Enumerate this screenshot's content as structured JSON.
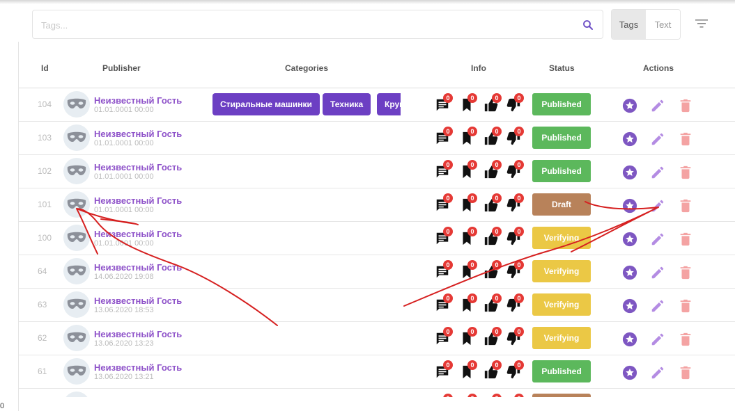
{
  "search": {
    "placeholder": "Tags..."
  },
  "toggle": {
    "tags_label": "Tags",
    "text_label": "Text"
  },
  "columns": [
    "Id",
    "Publisher",
    "Categories",
    "Info",
    "Status",
    "Actions"
  ],
  "corner_text": "0",
  "colors": {
    "published": "#5cb85c",
    "draft": "#b8825a",
    "verifying": "#ebc845",
    "chip": "#6c3fc3",
    "publisher": "#8e52c9",
    "badge": "#e53935",
    "annotation": "#d62020"
  },
  "categories_row1": [
    "Стиральные машинки",
    "Техника",
    "Крупная бытовая техника"
  ],
  "rows": [
    {
      "id": "104",
      "name": "Неизвестный Гость",
      "date": "01.01.0001 00:00",
      "status": "Published",
      "comments": "0",
      "saves": "0",
      "likes": "0",
      "dislikes": "0"
    },
    {
      "id": "103",
      "name": "Неизвестный Гость",
      "date": "01.01.0001 00:00",
      "status": "Published",
      "comments": "0",
      "saves": "0",
      "likes": "0",
      "dislikes": "0"
    },
    {
      "id": "102",
      "name": "Неизвестный Гость",
      "date": "01.01.0001 00:00",
      "status": "Published",
      "comments": "0",
      "saves": "0",
      "likes": "0",
      "dislikes": "0"
    },
    {
      "id": "101",
      "name": "Неизвестный Гость",
      "date": "01.01.0001 00:00",
      "status": "Draft",
      "comments": "0",
      "saves": "0",
      "likes": "0",
      "dislikes": "0"
    },
    {
      "id": "100",
      "name": "Неизвестный Гость",
      "date": "01.01.0001 00:00",
      "status": "Verifying",
      "comments": "0",
      "saves": "0",
      "likes": "0",
      "dislikes": "0"
    },
    {
      "id": "64",
      "name": "Неизвестный Гость",
      "date": "14.06.2020 19:08",
      "status": "Verifying",
      "comments": "0",
      "saves": "0",
      "likes": "0",
      "dislikes": "0"
    },
    {
      "id": "63",
      "name": "Неизвестный Гость",
      "date": "13.06.2020 18:53",
      "status": "Verifying",
      "comments": "0",
      "saves": "0",
      "likes": "0",
      "dislikes": "0"
    },
    {
      "id": "62",
      "name": "Неизвестный Гость",
      "date": "13.06.2020 13:23",
      "status": "Verifying",
      "comments": "0",
      "saves": "0",
      "likes": "0",
      "dislikes": "0"
    },
    {
      "id": "61",
      "name": "Неизвестный Гость",
      "date": "13.06.2020 13:21",
      "status": "Published",
      "comments": "0",
      "saves": "0",
      "likes": "0",
      "dislikes": "0"
    },
    {
      "id": "",
      "name": "",
      "date": "",
      "status": "Draft",
      "comments": "0",
      "saves": "0",
      "likes": "0",
      "dislikes": "0"
    }
  ],
  "icons": {
    "search": "search-icon",
    "filter": "filter-list-icon",
    "avatar": "mask-icon",
    "comments": "comment-icon",
    "saves": "bookmark-icon",
    "likes": "thumb-up-icon",
    "dislikes": "thumb-down-icon",
    "feature": "star-icon",
    "edit": "pencil-icon",
    "delete": "trash-icon"
  }
}
